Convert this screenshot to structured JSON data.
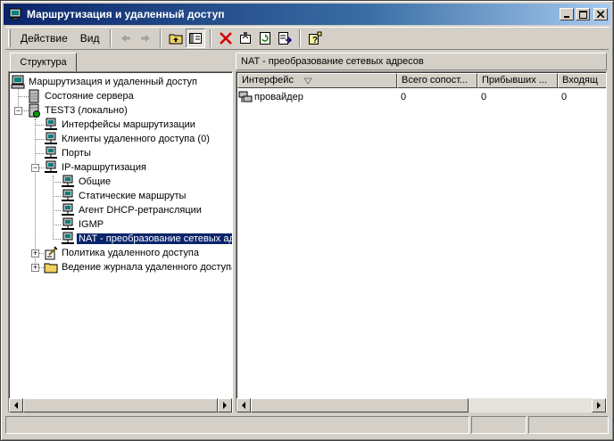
{
  "window": {
    "title": "Маршрутизация и удаленный доступ",
    "controls": [
      "minimize",
      "maximize",
      "close"
    ]
  },
  "toolbar": {
    "menu": [
      "Действие",
      "Вид"
    ],
    "icons": [
      "back-arrow-icon",
      "forward-arrow-icon",
      "up-folder-icon",
      "show-hide-tree-icon",
      "delete-icon",
      "properties-icon",
      "refresh-icon",
      "export-list-icon",
      "help-icon"
    ]
  },
  "left_pane": {
    "tab_label": "Структура",
    "tree": [
      {
        "label": "Маршрутизация и удаленный доступ",
        "icon": "computer-icon",
        "level": 0
      },
      {
        "label": "Состояние сервера",
        "icon": "server-icon",
        "level": 1
      },
      {
        "label": "TEST3 (локально)",
        "icon": "server-node-icon",
        "level": 1,
        "expander": "-"
      },
      {
        "label": "Интерфейсы маршрутизации",
        "icon": "network-icon",
        "level": 2
      },
      {
        "label": "Клиенты удаленного доступа (0)",
        "icon": "network-icon",
        "level": 2
      },
      {
        "label": "Порты",
        "icon": "network-icon",
        "level": 2
      },
      {
        "label": "IP-маршрутизация",
        "icon": "network-icon",
        "level": 2,
        "expander": "-"
      },
      {
        "label": "Общие",
        "icon": "network-icon",
        "level": 3
      },
      {
        "label": "Статические маршруты",
        "icon": "network-icon",
        "level": 3
      },
      {
        "label": "Агент DHCP-ретрансляции",
        "icon": "network-icon",
        "level": 3
      },
      {
        "label": "IGMP",
        "icon": "network-icon",
        "level": 3
      },
      {
        "label": "NAT - преобразование сетевых адресов",
        "icon": "network-icon",
        "level": 3,
        "selected": true
      },
      {
        "label": "Политика удаленного доступа",
        "icon": "policy-icon",
        "level": 2,
        "expander": "+"
      },
      {
        "label": "Ведение журнала удаленного доступа",
        "icon": "folder-icon",
        "level": 2,
        "expander": "+"
      }
    ]
  },
  "right_pane": {
    "header": "NAT - преобразование сетевых адресов",
    "columns": [
      "Интерфейс",
      "Всего сопост...",
      "Прибывших ...",
      "Входящ"
    ],
    "rows": [
      {
        "cells": [
          "провайдер",
          "0",
          "0",
          "0"
        ]
      }
    ]
  },
  "colors": {
    "selection": "#0a246a",
    "face": "#d4d0c8"
  }
}
